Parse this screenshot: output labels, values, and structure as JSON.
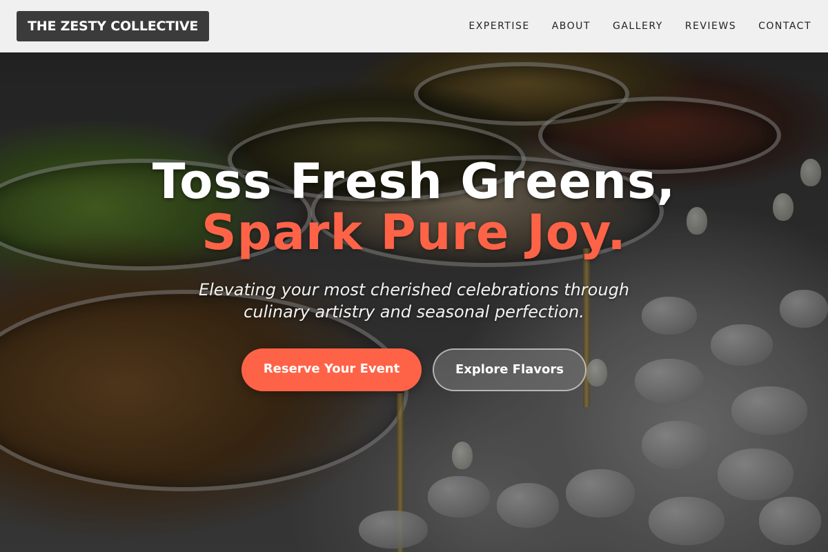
{
  "header": {
    "logo": "THE ZESTY COLLECTIVE",
    "nav": [
      {
        "label": "EXPERTISE"
      },
      {
        "label": "ABOUT"
      },
      {
        "label": "GALLERY"
      },
      {
        "label": "REVIEWS"
      },
      {
        "label": "CONTACT"
      }
    ]
  },
  "hero": {
    "headline_line1": "Toss Fresh Greens,",
    "headline_line2": "Spark Pure Joy.",
    "subtitle": "Elevating your most cherished celebrations through culinary artistry and seasonal perfection.",
    "primary_cta": "Reserve Your Event",
    "secondary_cta": "Explore Flavors"
  },
  "colors": {
    "accent": "#ff6347",
    "header_bg": "#f0f0f0",
    "logo_bg": "#3b3b3b",
    "text_light": "#ffffff"
  }
}
